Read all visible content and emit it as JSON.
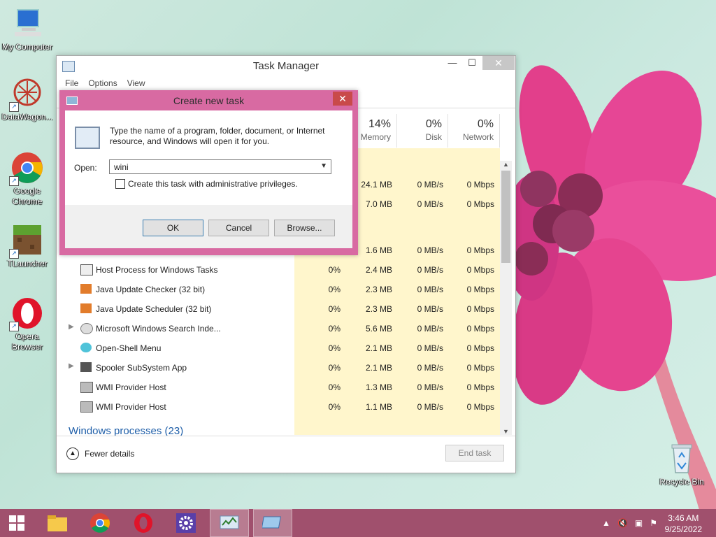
{
  "desktop": {
    "icons": [
      {
        "label": "My Computer",
        "icon": "computer-icon"
      },
      {
        "label": "DataWagon...",
        "icon": "datawagon-icon"
      },
      {
        "label": "Google Chrome",
        "icon": "chrome-icon"
      },
      {
        "label": "TLauncher",
        "icon": "minecraft-icon"
      },
      {
        "label": "Opera Browser",
        "icon": "opera-icon"
      },
      {
        "label": "Recycle Bin",
        "icon": "recycle-bin-icon"
      }
    ]
  },
  "task_manager": {
    "title": "Task Manager",
    "menu": [
      "File",
      "Options",
      "View"
    ],
    "columns": {
      "memory": {
        "pct": "14%",
        "label": "Memory"
      },
      "disk": {
        "pct": "0%",
        "label": "Disk"
      },
      "network": {
        "pct": "0%",
        "label": "Network"
      }
    },
    "partial_rows": [
      {
        "memory": "24.1 MB",
        "disk": "0 MB/s",
        "network": "0 Mbps"
      },
      {
        "memory": "7.0 MB",
        "disk": "0 MB/s",
        "network": "0 Mbps"
      },
      {
        "memory": "1.6 MB",
        "disk": "0 MB/s",
        "network": "0 Mbps"
      }
    ],
    "rows": [
      {
        "name": "Host Process for Windows Tasks",
        "cpu": "0%",
        "memory": "2.4 MB",
        "disk": "0 MB/s",
        "network": "0 Mbps",
        "expand": false
      },
      {
        "name": "Java Update Checker (32 bit)",
        "cpu": "0%",
        "memory": "2.3 MB",
        "disk": "0 MB/s",
        "network": "0 Mbps",
        "expand": false
      },
      {
        "name": "Java Update Scheduler (32 bit)",
        "cpu": "0%",
        "memory": "2.3 MB",
        "disk": "0 MB/s",
        "network": "0 Mbps",
        "expand": false
      },
      {
        "name": "Microsoft Windows Search Inde...",
        "cpu": "0%",
        "memory": "5.6 MB",
        "disk": "0 MB/s",
        "network": "0 Mbps",
        "expand": true
      },
      {
        "name": "Open-Shell Menu",
        "cpu": "0%",
        "memory": "2.1 MB",
        "disk": "0 MB/s",
        "network": "0 Mbps",
        "expand": false
      },
      {
        "name": "Spooler SubSystem App",
        "cpu": "0%",
        "memory": "2.1 MB",
        "disk": "0 MB/s",
        "network": "0 Mbps",
        "expand": true
      },
      {
        "name": "WMI Provider Host",
        "cpu": "0%",
        "memory": "1.3 MB",
        "disk": "0 MB/s",
        "network": "0 Mbps",
        "expand": false
      },
      {
        "name": "WMI Provider Host",
        "cpu": "0%",
        "memory": "1.1 MB",
        "disk": "0 MB/s",
        "network": "0 Mbps",
        "expand": false
      }
    ],
    "group_label": "Windows processes (23)",
    "fewer_details": "Fewer details",
    "end_task": "End task"
  },
  "run_dialog": {
    "title": "Create new task",
    "description": "Type the name of a program, folder, document, or Internet resource, and Windows will open it for you.",
    "open_label": "Open:",
    "open_value": "wini",
    "admin_label": "Create this task with administrative privileges.",
    "ok": "OK",
    "cancel": "Cancel",
    "browse": "Browse..."
  },
  "taskbar": {
    "time": "3:46 AM",
    "date": "9/25/2022"
  },
  "colors": {
    "taskbar": "#a0506d",
    "dialog_frame": "#d86aa2",
    "column_highlight": "#fff6cc"
  }
}
